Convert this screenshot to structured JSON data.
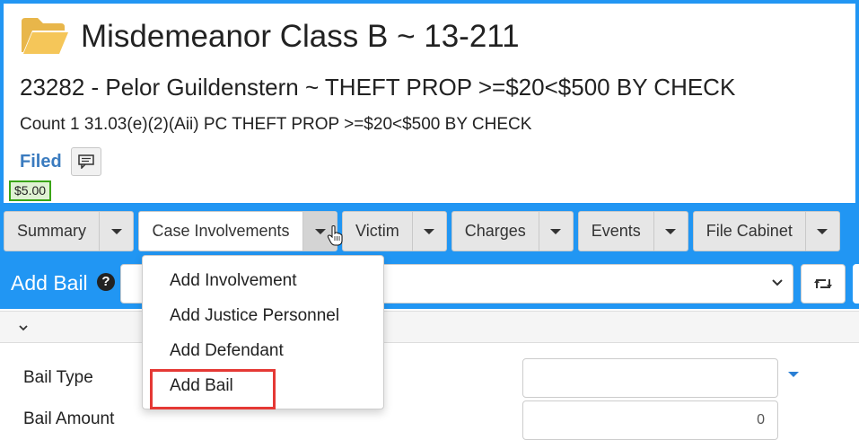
{
  "case": {
    "title": "Misdemeanor Class B ~ 13-211",
    "defendant_line": "23282 - Pelor Guildenstern ~ THEFT PROP >=$20<$500 BY CHECK",
    "count_line": "Count 1 31.03(e)(2)(Aii) PC THEFT PROP >=$20<$500 BY CHECK",
    "status": "Filed",
    "fee": "$5.00",
    "icon": "folder-open-icon"
  },
  "tabs": [
    {
      "label": "Summary"
    },
    {
      "label": "Case Involvements"
    },
    {
      "label": "Victim"
    },
    {
      "label": "Charges"
    },
    {
      "label": "Events"
    },
    {
      "label": "File Cabinet"
    }
  ],
  "bail_bar": {
    "title": "Add Bail",
    "select_value": ""
  },
  "menu": {
    "items": [
      "Add Involvement",
      "Add Justice Personnel",
      "Add Defendant",
      "Add Bail"
    ],
    "highlighted": "Add Bail"
  },
  "form": {
    "fields": [
      {
        "label": "Bail Type",
        "value": ""
      },
      {
        "label": "Bail Amount",
        "value": "0"
      }
    ]
  },
  "colors": {
    "accent": "#2196f3",
    "status": "#3a7bbf",
    "fee_border": "#3aa516",
    "highlight_border": "#e53935"
  }
}
